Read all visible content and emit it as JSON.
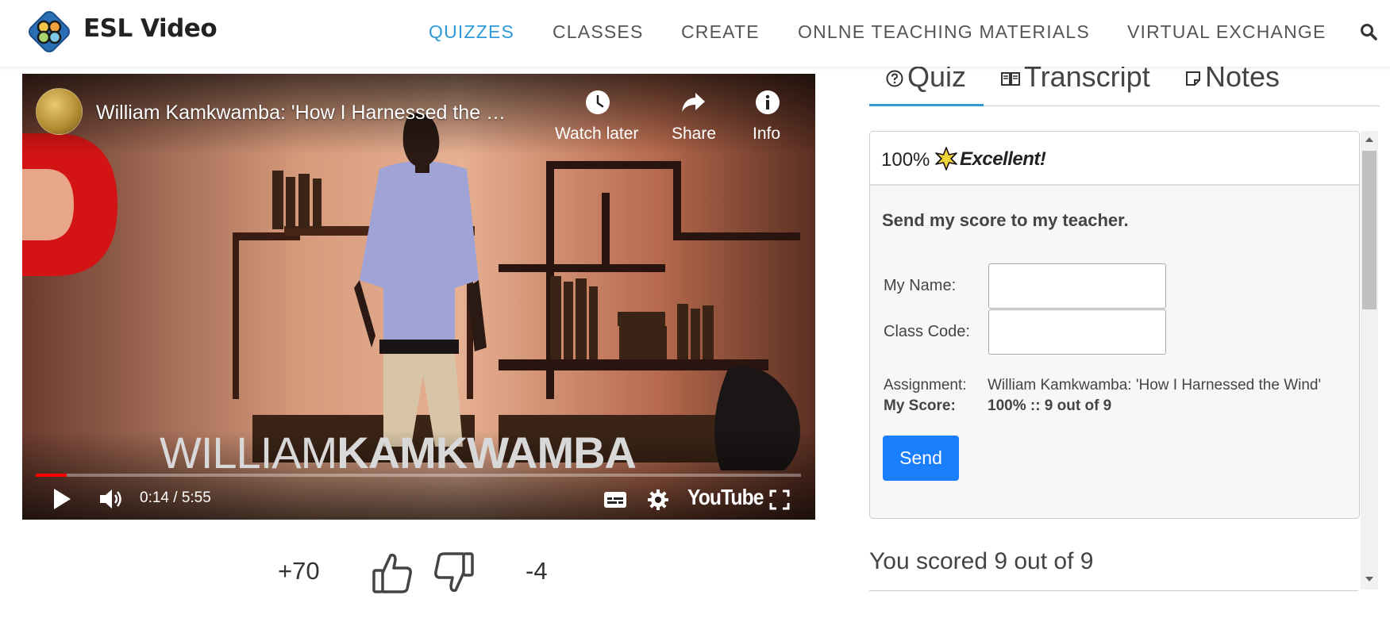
{
  "header": {
    "brand": "ESL Video",
    "nav": [
      "QUIZZES",
      "CLASSES",
      "CREATE",
      "ONLNE TEACHING MATERIALS",
      "VIRTUAL EXCHANGE"
    ],
    "active_nav": "QUIZZES",
    "accent_color": "#2e9ad8",
    "search_icon": "search-icon"
  },
  "video": {
    "title": "William Kamkwamba: 'How I Harnessed the …",
    "watch_later_label": "Watch later",
    "share_label": "Share",
    "info_label": "Info",
    "lower_third_first": "WILLIAM",
    "lower_third_last": "KAMKWAMBA",
    "time_display": "0:14 / 5:55",
    "progress_fraction": 0.04,
    "youtube_label": "YouTube",
    "progress_color": "#ff0000"
  },
  "votes": {
    "up": "+70",
    "down": "-4"
  },
  "tabs": [
    {
      "label": "Quiz",
      "icon": "question-circle-icon",
      "active": true
    },
    {
      "label": "Transcript",
      "icon": "book-icon",
      "active": false
    },
    {
      "label": "Notes",
      "icon": "note-icon",
      "active": false
    }
  ],
  "quiz": {
    "score_percent": "100%",
    "score_word": "Excellent!",
    "send_heading": "Send my score to my teacher.",
    "name_label": "My Name:",
    "name_value": "",
    "class_code_label": "Class Code:",
    "class_code_value": "",
    "assignment_label": "Assignment:",
    "assignment_value": "William Kamkwamba: 'How I Harnessed the Wind'",
    "my_score_label": "My Score:",
    "my_score_value": "100% :: 9 out of 9",
    "send_button": "Send",
    "button_color": "#1a7ffd",
    "result_text": "You scored 9 out of 9"
  }
}
